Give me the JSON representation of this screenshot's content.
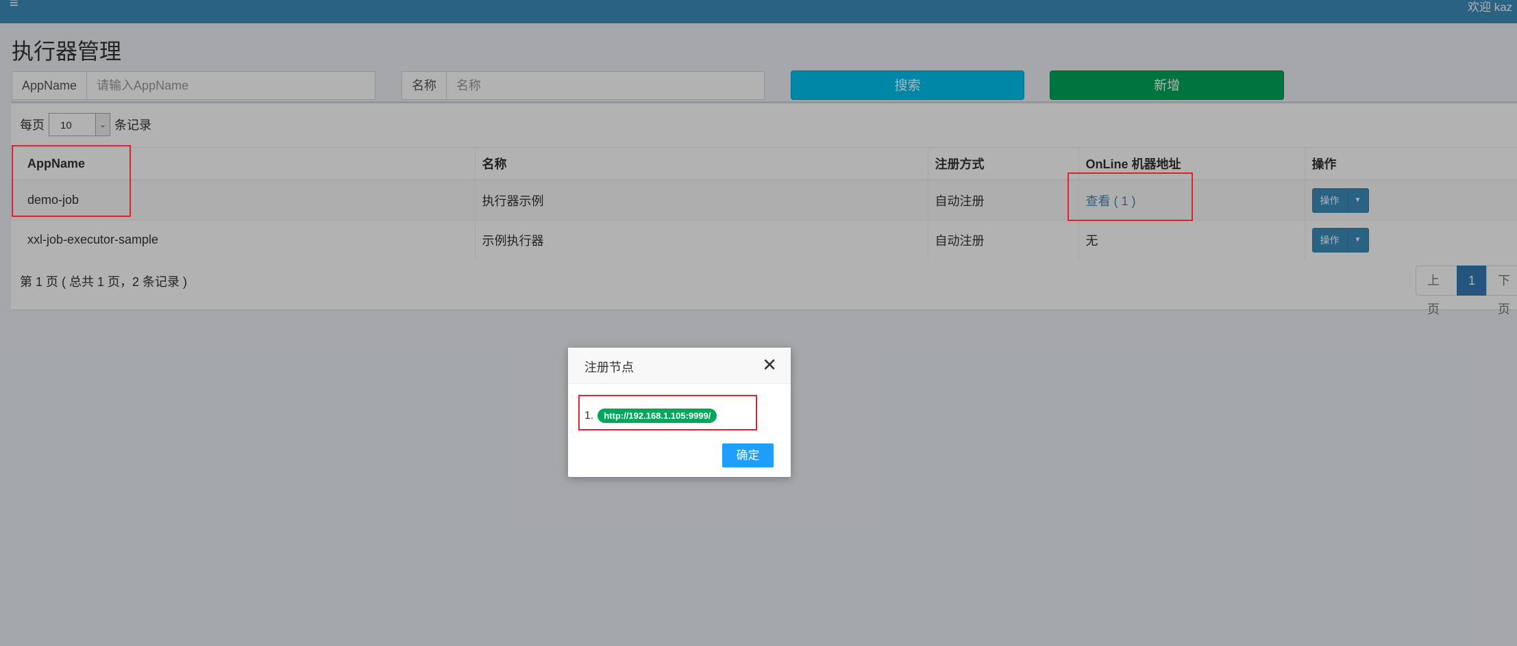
{
  "header": {
    "menu_icon": "hamburger-icon",
    "welcome": "欢迎 kaz"
  },
  "page": {
    "title": "执行器管理"
  },
  "filters": {
    "appname_label": "AppName",
    "appname_placeholder": "请输入AppName",
    "name_label": "名称",
    "name_placeholder": "名称",
    "search_button": "搜索",
    "add_button": "新增"
  },
  "length": {
    "prefix": "每页",
    "value": "10",
    "suffix": "条记录"
  },
  "table": {
    "columns": [
      "AppName",
      "名称",
      "注册方式",
      "OnLine 机器地址",
      "操作"
    ],
    "rows": [
      {
        "appname": "demo-job",
        "name": "执行器示例",
        "reg": "自动注册",
        "online": "查看 ( 1 )",
        "action": "操作"
      },
      {
        "appname": "xxl-job-executor-sample",
        "name": "示例执行器",
        "reg": "自动注册",
        "online": "无",
        "action": "操作"
      }
    ]
  },
  "pagination": {
    "info": "第 1 页 ( 总共 1 页，2 条记录 )",
    "prev": "上页",
    "current": "1",
    "next": "下页"
  },
  "modal": {
    "title": "注册节点",
    "item_index": "1.",
    "address": "http://192.168.1.105:9999/",
    "ok": "确定"
  },
  "colors": {
    "header": "#3c8dbc",
    "search": "#00c0ef",
    "add": "#00a65a",
    "highlight": "#e3202d",
    "confirm": "#1e9fff"
  }
}
